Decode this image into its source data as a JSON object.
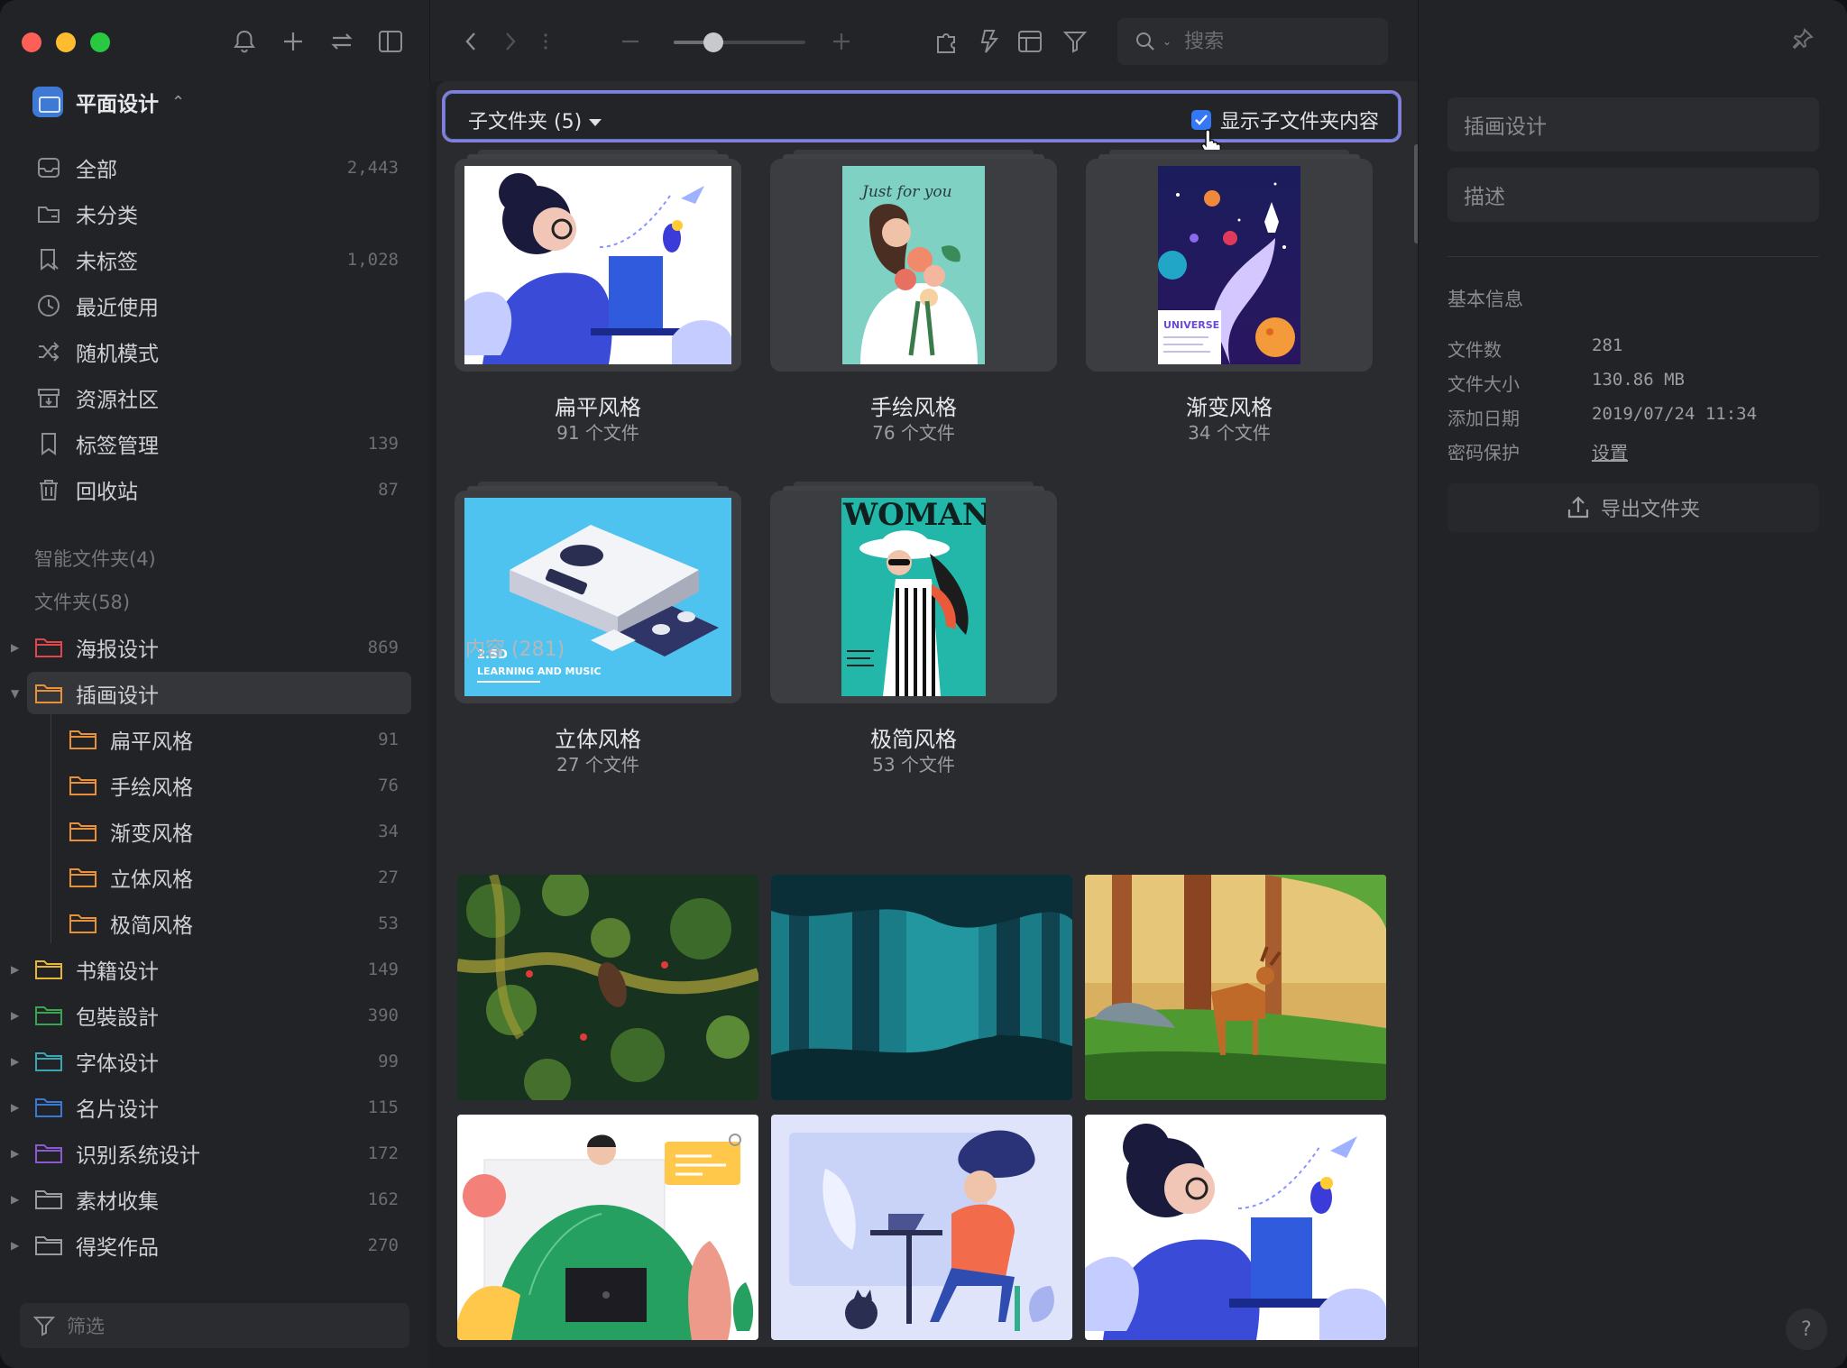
{
  "library": {
    "name": "平面设计"
  },
  "nav": [
    {
      "label": "全部",
      "count": "2,443",
      "icon": "inbox-icon"
    },
    {
      "label": "未分类",
      "count": "",
      "icon": "uncategorized-icon"
    },
    {
      "label": "未标签",
      "count": "1,028",
      "icon": "untagged-icon"
    },
    {
      "label": "最近使用",
      "count": "",
      "icon": "clock-icon"
    },
    {
      "label": "随机模式",
      "count": "",
      "icon": "shuffle-icon"
    },
    {
      "label": "资源社区",
      "count": "",
      "icon": "community-icon"
    },
    {
      "label": "标签管理",
      "count": "139",
      "icon": "bookmark-icon"
    },
    {
      "label": "回收站",
      "count": "87",
      "icon": "trash-icon"
    }
  ],
  "sections": {
    "smart_folders": "智能文件夹(4)",
    "folders": "文件夹(58)"
  },
  "folders": [
    {
      "label": "海报设计",
      "count": "869",
      "color": "#e0474c"
    },
    {
      "label": "插画设计",
      "count": "",
      "color": "#e8913a"
    },
    {
      "label": "扁平风格",
      "count": "91",
      "color": "#e8913a"
    },
    {
      "label": "手绘风格",
      "count": "76",
      "color": "#e8913a"
    },
    {
      "label": "渐变风格",
      "count": "34",
      "color": "#e8913a"
    },
    {
      "label": "立体风格",
      "count": "27",
      "color": "#e8913a"
    },
    {
      "label": "极简风格",
      "count": "53",
      "color": "#e8913a"
    },
    {
      "label": "书籍设计",
      "count": "149",
      "color": "#e5b53a"
    },
    {
      "label": "包裝設計",
      "count": "390",
      "color": "#38a651"
    },
    {
      "label": "字体设计",
      "count": "99",
      "color": "#3aa6b5"
    },
    {
      "label": "名片设计",
      "count": "115",
      "color": "#3a78d6"
    },
    {
      "label": "识别系统设计",
      "count": "172",
      "color": "#8a5bd0"
    },
    {
      "label": "素材收集",
      "count": "162",
      "color": "#9a9ba0"
    },
    {
      "label": "得奖作品",
      "count": "270",
      "color": "#9a9ba0"
    }
  ],
  "filter": {
    "placeholder": "筛选"
  },
  "toolbar": {
    "search_placeholder": "搜索",
    "zoom_level": 0.3
  },
  "subfolders": {
    "dropdown_label": "子文件夹 (5)",
    "show_contents_label": "显示子文件夹内容",
    "show_contents_checked": true,
    "cards": [
      {
        "name": "扁平风格",
        "count": "91 个文件",
        "art": "flat"
      },
      {
        "name": "手绘风格",
        "count": "76 个文件",
        "art": "hand"
      },
      {
        "name": "渐变风格",
        "count": "34 个文件",
        "art": "gradient"
      },
      {
        "name": "立体风格",
        "count": "27 个文件",
        "art": "iso"
      },
      {
        "name": "极简风格",
        "count": "53 个文件",
        "art": "minimal"
      }
    ],
    "card_text": {
      "hand_script": "Just for you",
      "universe_text": "UNIVERSE",
      "iso_text": "2.5D",
      "iso_text2": "LEARNING AND MUSIC",
      "woman_text": "WOMAN"
    }
  },
  "content": {
    "label": "内容 (281)"
  },
  "inspector": {
    "name_value": "插画设计",
    "desc_placeholder": "描述",
    "info_title": "基本信息",
    "rows": [
      {
        "key": "文件数",
        "value": "281"
      },
      {
        "key": "文件大小",
        "value": "130.86 MB"
      },
      {
        "key": "添加日期",
        "value": "2019/07/24 11:34"
      },
      {
        "key": "密码保护",
        "value": "设置"
      }
    ],
    "export_label": "导出文件夹",
    "help_label": "?"
  },
  "colors": {
    "accent": "#3478f6",
    "selection_border": "#8a7dd8"
  }
}
